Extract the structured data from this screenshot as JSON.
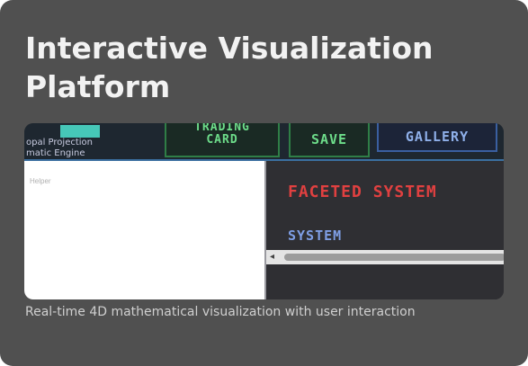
{
  "card": {
    "title": "Interactive Visualization Platform",
    "caption": "Real-time 4D mathematical visualization with user interaction"
  },
  "preview": {
    "left_text_1": "opal Projection",
    "left_text_2": "matic Engine",
    "trading_card_line1": "TRADING",
    "trading_card_line2": "CARD",
    "save_label": "SAVE",
    "gallery_label": "GALLERY",
    "placeholder": "Helper",
    "faceted_label": "FACETED SYSTEM",
    "system_label": "SYSTEM",
    "scroll_arrow": "◂"
  },
  "colors": {
    "card_bg": "#505050",
    "green_accent": "#6ddd8a",
    "red_accent": "#e04040",
    "blue_accent": "#7f9fe6"
  }
}
